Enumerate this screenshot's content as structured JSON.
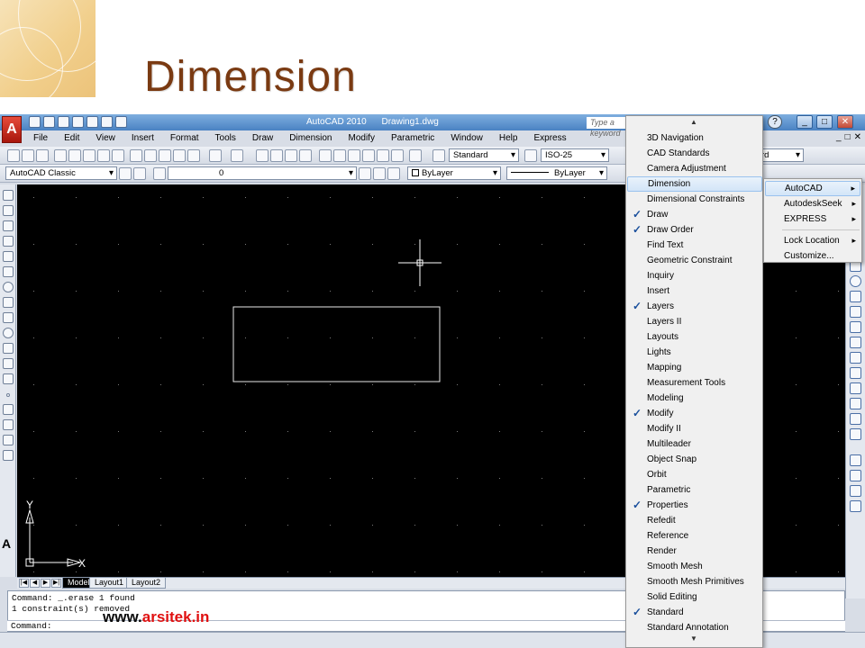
{
  "slide": {
    "title": "Dimension",
    "watermark_part1": "www.",
    "watermark_part2": "arsitek.in"
  },
  "app": {
    "name": "AutoCAD 2010",
    "document": "Drawing1.dwg",
    "search_placeholder": "Type a keyword",
    "logo_letter": "A",
    "help_label": "?",
    "window_buttons": [
      "_",
      "□",
      "✕"
    ],
    "menu": [
      "File",
      "Edit",
      "View",
      "Insert",
      "Format",
      "Tools",
      "Draw",
      "Dimension",
      "Modify",
      "Parametric",
      "Window",
      "Help",
      "Express"
    ],
    "mdi_controls": [
      "_",
      "□",
      "✕"
    ]
  },
  "toolbars": {
    "text_style": "Standard",
    "dim_style": "ISO-25",
    "workspace": "AutoCAD Classic",
    "layer": "0",
    "color": "ByLayer",
    "linetype": "ByLayer",
    "right_combo": "rd"
  },
  "palette": {
    "text_tool": "A"
  },
  "ucs": {
    "y_label": "Y",
    "x_label": "X"
  },
  "layout_tabs": {
    "nav": [
      "|◀",
      "◀",
      "▶",
      "▶|"
    ],
    "tabs": [
      "Model",
      "Layout1",
      "Layout2"
    ],
    "active": "Model"
  },
  "command_line": {
    "history": [
      "Command: _.erase 1 found",
      "1 constraint(s) removed"
    ],
    "prompt": "Command:"
  },
  "context_menu": {
    "scroll_up": "▲",
    "scroll_down": "▼",
    "check_mark": "✓",
    "items": [
      {
        "label": "3D Navigation",
        "checked": false
      },
      {
        "label": "CAD Standards",
        "checked": false
      },
      {
        "label": "Camera Adjustment",
        "checked": false
      },
      {
        "label": "Dimension",
        "checked": false,
        "highlighted": true
      },
      {
        "label": "Dimensional Constraints",
        "checked": false
      },
      {
        "label": "Draw",
        "checked": true
      },
      {
        "label": "Draw Order",
        "checked": true
      },
      {
        "label": "Find Text",
        "checked": false
      },
      {
        "label": "Geometric Constraint",
        "checked": false
      },
      {
        "label": "Inquiry",
        "checked": false
      },
      {
        "label": "Insert",
        "checked": false
      },
      {
        "label": "Layers",
        "checked": true
      },
      {
        "label": "Layers II",
        "checked": false
      },
      {
        "label": "Layouts",
        "checked": false
      },
      {
        "label": "Lights",
        "checked": false
      },
      {
        "label": "Mapping",
        "checked": false
      },
      {
        "label": "Measurement Tools",
        "checked": false
      },
      {
        "label": "Modeling",
        "checked": false
      },
      {
        "label": "Modify",
        "checked": true
      },
      {
        "label": "Modify II",
        "checked": false
      },
      {
        "label": "Multileader",
        "checked": false
      },
      {
        "label": "Object Snap",
        "checked": false
      },
      {
        "label": "Orbit",
        "checked": false
      },
      {
        "label": "Parametric",
        "checked": false
      },
      {
        "label": "Properties",
        "checked": true
      },
      {
        "label": "Refedit",
        "checked": false
      },
      {
        "label": "Reference",
        "checked": false
      },
      {
        "label": "Render",
        "checked": false
      },
      {
        "label": "Smooth Mesh",
        "checked": false
      },
      {
        "label": "Smooth Mesh Primitives",
        "checked": false
      },
      {
        "label": "Solid Editing",
        "checked": false
      },
      {
        "label": "Standard",
        "checked": true
      },
      {
        "label": "Standard Annotation",
        "checked": false
      }
    ]
  },
  "sub_menu": {
    "items": [
      {
        "label": "AutoCAD",
        "has_submenu": true,
        "highlighted": true
      },
      {
        "label": "AutodeskSeek",
        "has_submenu": true
      },
      {
        "label": "EXPRESS",
        "has_submenu": true
      },
      {
        "label": "Lock Location",
        "has_submenu": true
      },
      {
        "label": "Customize...",
        "has_submenu": false
      }
    ],
    "caret": "▸"
  },
  "colors": {
    "title_color": "#7a3a12",
    "canvas_bg": "#000000",
    "accent": "#4a82c3",
    "watermark_red": "#e01010"
  }
}
